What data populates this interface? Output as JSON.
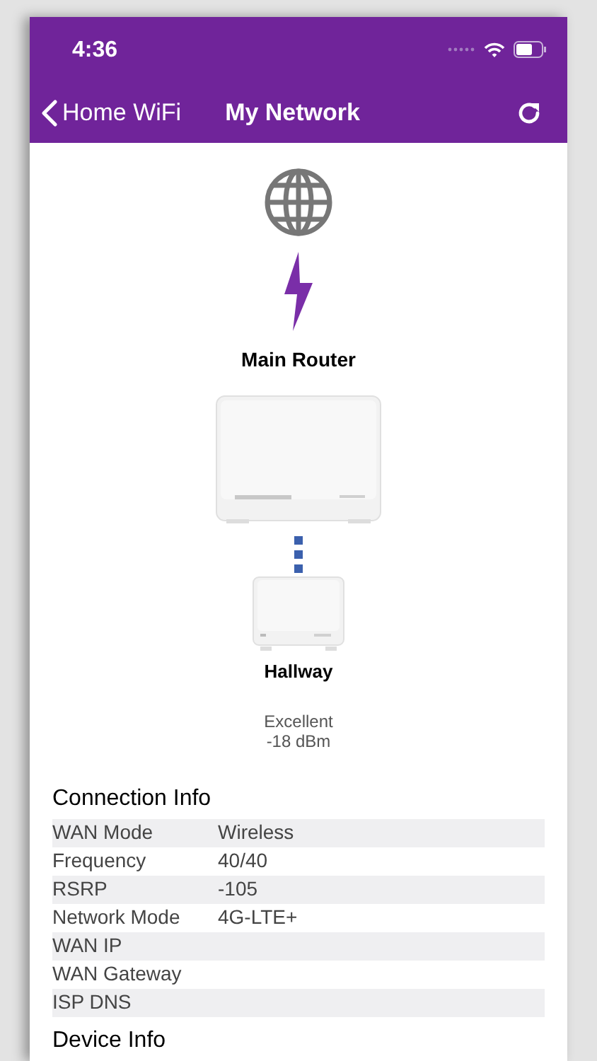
{
  "status_bar": {
    "time": "4:36"
  },
  "nav": {
    "back": "Home WiFi",
    "title": "My Network"
  },
  "topology": {
    "main": "Main Router",
    "satellite": "Hallway",
    "quality": "Excellent",
    "reading": "-18 dBm"
  },
  "connection_info": {
    "title": "Connection Info",
    "rows": [
      {
        "label": "WAN Mode",
        "value": "Wireless"
      },
      {
        "label": "Frequency",
        "value": "40/40"
      },
      {
        "label": "RSRP",
        "value": "-105"
      },
      {
        "label": "Network Mode",
        "value": "4G-LTE+"
      },
      {
        "label": "WAN IP"
      },
      {
        "label": "WAN Gateway"
      },
      {
        "label": "ISP DNS"
      }
    ]
  },
  "device_info": {
    "title": "Device Info"
  }
}
